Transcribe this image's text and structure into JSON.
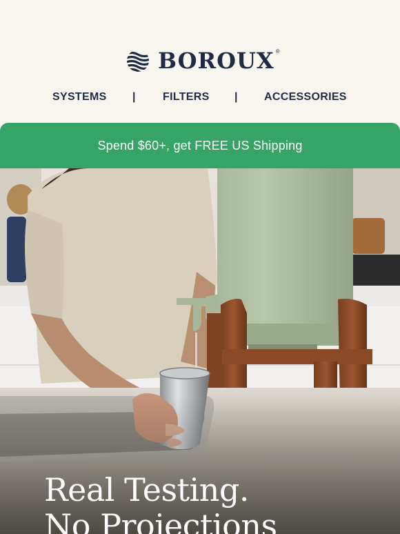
{
  "brand": {
    "name": "BOROUX",
    "registered": "®",
    "logo_icon": "waves-globe-icon",
    "color": "#1f2a44"
  },
  "nav": {
    "items": [
      "SYSTEMS",
      "FILTERS",
      "ACCESSORIES"
    ],
    "separator": "|"
  },
  "banner": {
    "text": "Spend $60+, get FREE US Shipping",
    "color": "#36a466"
  },
  "hero": {
    "title_line1": "Real Testing.",
    "title_line2": "No Projections"
  }
}
